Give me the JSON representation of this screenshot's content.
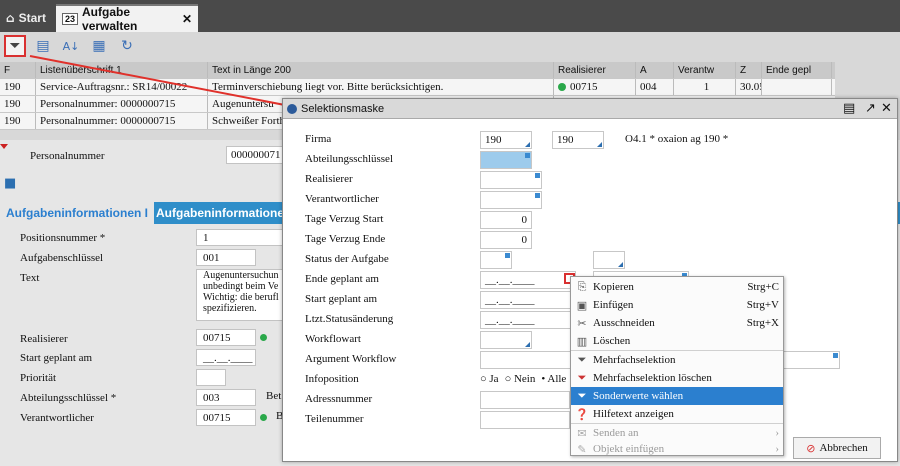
{
  "tabs": {
    "start": "Start",
    "active": "Aufgabe verwalten",
    "active_icon_text": "23"
  },
  "grid": {
    "headers": [
      "F",
      "Listenüberschrift 1",
      "Text in Länge 200",
      "Realisierer",
      "A",
      "Verantw",
      "Z",
      "Ende gepl"
    ],
    "rows": [
      [
        "190",
        "Service-Auftragsnr.: SR14/00022",
        "Terminverschiebung liegt vor. Bitte berücksichtigen.",
        "00715",
        "004",
        "1",
        "30.05.2015"
      ],
      [
        "190",
        "Personalnummer: 0000000715",
        "Augenuntersu",
        "",
        "",
        "",
        ""
      ],
      [
        "190",
        "Personalnummer: 0000000715",
        "Schweißer Forth",
        "",
        "",
        "",
        ""
      ]
    ]
  },
  "detail": {
    "personal_label": "Personalnummer",
    "personal_value": "000000071",
    "tab1": "Aufgabeninformationen I",
    "tab2": "Aufgabeninformationen",
    "fields": [
      {
        "label": "Positionsnummer *",
        "value": "1"
      },
      {
        "label": "Aufgabenschlüssel",
        "value": "001"
      },
      {
        "label": "Text",
        "value": "Augenuntersuchun unbedingt beim Ve Wichtig: die berufl spezifizieren."
      },
      {
        "label": "Realisierer",
        "value": "00715"
      },
      {
        "label": "Start geplant am",
        "value": "__.__.____"
      },
      {
        "label": "Priorität",
        "value": ""
      },
      {
        "label": "Abteilungsschlüssel *",
        "value": "003"
      },
      {
        "label": "Verantwortlicher",
        "value": "00715"
      }
    ],
    "side1": "Bet",
    "side2": "B"
  },
  "dialog": {
    "title": "Selektionsmaske",
    "firma_from": "190",
    "firma_to": "190",
    "firma_info": "O4.1 * oxaion ag 190   *",
    "rows": [
      "Firma",
      "Abteilungsschlüssel",
      "Realisierer",
      "Verantwortlicher",
      "Tage Verzug Start",
      "Tage Verzug Ende",
      "Status der Aufgabe",
      "Ende  geplant am",
      "Start geplant am",
      "Ltzt.Statusänderung",
      "Workflowart",
      "Argument Workflow",
      "Infoposition",
      "Adressnummer",
      "Teilenummer"
    ],
    "tage_start": "0",
    "tage_ende": "0",
    "date_placeholder": "__.__.____",
    "radio_ja": "Ja",
    "radio_nein": "Nein",
    "radio_alle": "Alle",
    "cancel": "Abbrechen"
  },
  "context_menu": [
    {
      "icon": "copy-icon",
      "label": "Kopieren",
      "shortcut": "Strg+C"
    },
    {
      "icon": "paste-icon",
      "label": "Einfügen",
      "shortcut": "Strg+V"
    },
    {
      "icon": "cut-icon",
      "label": "Ausschneiden",
      "shortcut": "Strg+X"
    },
    {
      "icon": "trash-icon",
      "label": "Löschen",
      "shortcut": ""
    },
    {
      "icon": "filter-icon",
      "label": "Mehrfachselektion",
      "shortcut": ""
    },
    {
      "icon": "filter-delete-icon",
      "label": "Mehrfachselektion löschen",
      "shortcut": ""
    },
    {
      "icon": "filter-special-icon",
      "label": "Sonderwerte wählen",
      "shortcut": ""
    },
    {
      "icon": "help-icon",
      "label": "Hilfetext anzeigen",
      "shortcut": ""
    },
    {
      "icon": "send-icon",
      "label": "Senden an",
      "shortcut": ""
    },
    {
      "icon": "insert-object-icon",
      "label": "Objekt einfügen",
      "shortcut": ""
    }
  ],
  "colors": {
    "accent": "#2b7fcf",
    "highlight": "#d93030",
    "status_green": "#2aa84a"
  }
}
